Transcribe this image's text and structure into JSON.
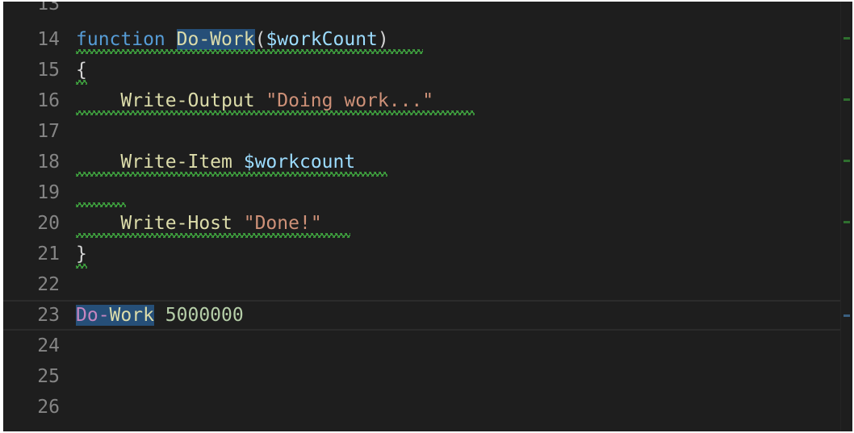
{
  "editor": {
    "language": "powershell",
    "lines": [
      {
        "number": "13",
        "text": ""
      },
      {
        "number": "14",
        "text": "function Do-Work($workCount)"
      },
      {
        "number": "15",
        "text": "{"
      },
      {
        "number": "16",
        "text": "    Write-Output \"Doing work...\""
      },
      {
        "number": "17",
        "text": ""
      },
      {
        "number": "18",
        "text": "    Write-Item $workcount"
      },
      {
        "number": "19",
        "text": ""
      },
      {
        "number": "20",
        "text": "    Write-Host \"Done!\""
      },
      {
        "number": "21",
        "text": "}"
      },
      {
        "number": "22",
        "text": ""
      },
      {
        "number": "23",
        "text": "Do-Work 5000000"
      },
      {
        "number": "24",
        "text": ""
      },
      {
        "number": "25",
        "text": ""
      },
      {
        "number": "26",
        "text": ""
      }
    ],
    "tokens": {
      "kw_function": "function",
      "fn_name": "Do-Work",
      "open_paren": "(",
      "param": "$workCount",
      "close_paren": ")",
      "brace_open": "{",
      "indent": "    ",
      "cmd_write_output": "Write-Output",
      "str_doing_work": "\"Doing work...\"",
      "cmd_write_item": "Write-Item",
      "var_workcount": "$workcount",
      "cmd_write_host": "Write-Host",
      "str_done": "\"Done!\"",
      "brace_close": "}",
      "call_do": "Do-",
      "call_work": "Work",
      "arg_number": "5000000",
      "space": " "
    },
    "current_line": "23",
    "colors": {
      "background": "#1e1e1e",
      "selection_highlight": "#264f78",
      "warning_squiggle": "#3fa33f",
      "line_number": "#858585"
    }
  }
}
